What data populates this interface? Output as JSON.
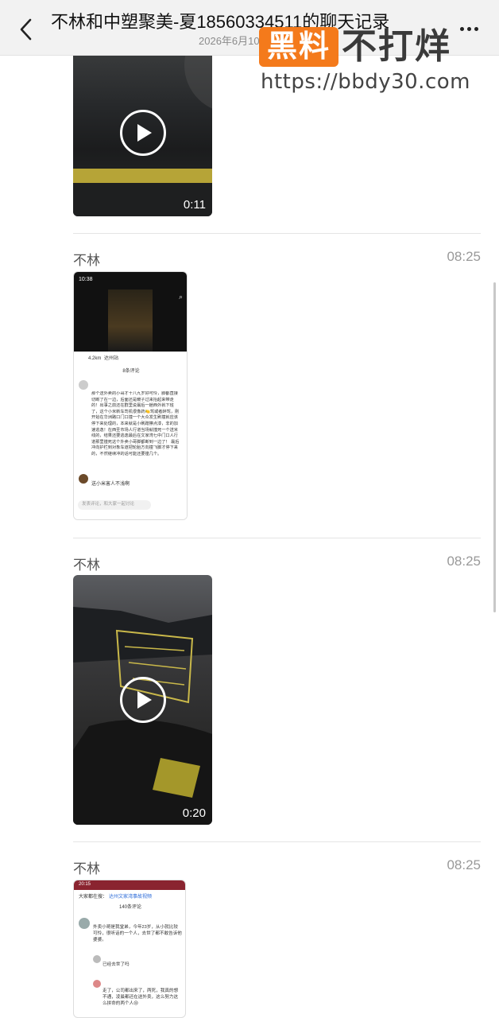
{
  "header": {
    "title": "不林和中塑聚美-夏18560334511的聊天记录",
    "subtitle": "2026年6月10日"
  },
  "watermark": {
    "badge": "黑料",
    "text": "不打烊",
    "url": "https://bbdy30.com"
  },
  "messages": [
    {
      "type": "video",
      "duration": "0:11"
    },
    {
      "type": "image",
      "sender": "不林",
      "time": "08:25",
      "shot": {
        "status_time": "10:38",
        "distance": "4.2km",
        "location": "达州站",
        "comment_count": "8条评论",
        "comment_body": "那个送外卖的小哥才十八九岁好可怜，脚都直接切断了在一边，后面还是暖子过来抬起来带走的！出事之前还在群里说最后一趟西外就下班了，这个小米新车司机很像药🍋驾或者醉驾，刚开始在华洲路口门口撞一个大众发生刷撞就应该停下来处理的，本来就是小刷蹭擦点漆，非的加速逃逸！在西圣市场人行道当场就撞死一个送米线的，结果还要逃逸最后在文家湾七中门口人行道那里撞死这个外卖小哥脚都断到一边了！ 最后冲向护栏到对象车道把轮胎方向撞飞脚才停下来的，不然继续冲的话可能还要撞几个。",
        "reply_text": "送小米害人不浅啊",
        "input_placeholder": "发表评论，和大家一起讨论"
      }
    },
    {
      "type": "video",
      "sender": "不林",
      "time": "08:25",
      "duration": "0:20"
    },
    {
      "type": "image",
      "sender": "不林",
      "time": "08:25",
      "shot": {
        "status_time": "20:15",
        "search_prefix": "大家都在搜：",
        "search_query": "达州文家湾事故视频",
        "comment_count": "140条评论",
        "c1_body": "外卖小哥是我堂弟，今年23岁，从小就比较可怜，很听话的一个人，去世了都不敢告诉他婆婆。",
        "c2_body": "已经去世了吗",
        "c3_body": "走了，公司都出来了，两死，我真的想不通，凌晨都还在送外卖，这么努力这么拼命的两个人😢"
      }
    }
  ]
}
